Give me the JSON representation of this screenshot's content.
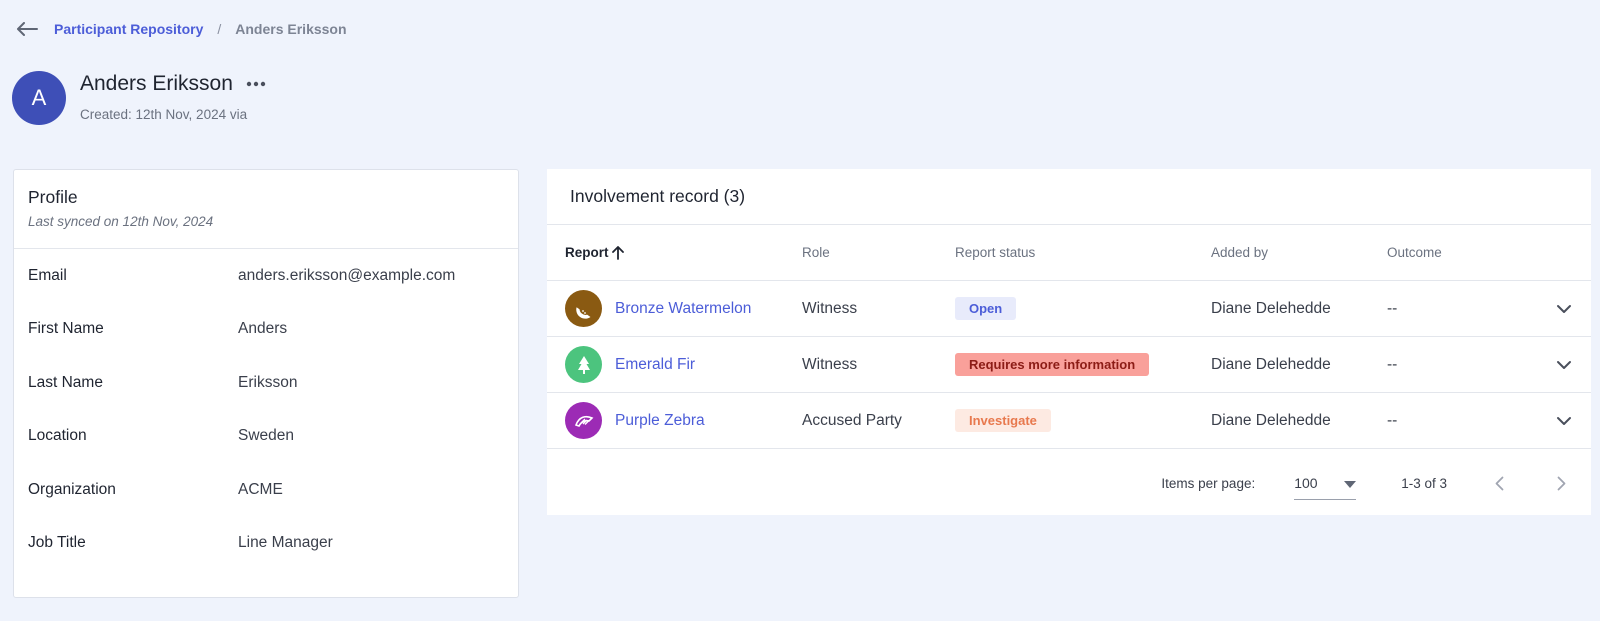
{
  "breadcrumb": {
    "parent": "Participant Repository",
    "separator": "/",
    "current": "Anders Eriksson"
  },
  "participant": {
    "initial": "A",
    "name": "Anders Eriksson",
    "created": "Created: 12th Nov, 2024 via",
    "avatar_color": "#3e4fb7"
  },
  "profile": {
    "title": "Profile",
    "last_synced": "Last synced on 12th Nov, 2024",
    "fields": [
      {
        "label": "Email",
        "value": "anders.eriksson@example.com"
      },
      {
        "label": "First Name",
        "value": "Anders"
      },
      {
        "label": "Last Name",
        "value": "Eriksson"
      },
      {
        "label": "Location",
        "value": "Sweden"
      },
      {
        "label": "Organization",
        "value": "ACME"
      },
      {
        "label": "Job Title",
        "value": "Line Manager"
      }
    ]
  },
  "involvement": {
    "title": "Involvement record (3)",
    "columns": {
      "report": "Report",
      "role": "Role",
      "status": "Report status",
      "added_by": "Added by",
      "outcome": "Outcome"
    },
    "rows": [
      {
        "report": "Bronze Watermelon",
        "icon": "watermelon-icon",
        "icon_color": "#8a5a12",
        "role": "Witness",
        "status": "Open",
        "status_bg": "#e8ebfb",
        "status_color": "#4c5dd8",
        "added_by": "Diane Delehedde",
        "outcome": "--"
      },
      {
        "report": "Emerald Fir",
        "icon": "fir-tree-icon",
        "icon_color": "#4cc47e",
        "role": "Witness",
        "status": "Requires more information",
        "status_bg": "#f9a09a",
        "status_color": "#8c1c16",
        "added_by": "Diane Delehedde",
        "outcome": "--"
      },
      {
        "report": "Purple Zebra",
        "icon": "zebra-icon",
        "icon_color": "#9c2bb5",
        "role": "Accused Party",
        "status": "Investigate",
        "status_bg": "#fdeae2",
        "status_color": "#e8794e",
        "added_by": "Diane Delehedde",
        "outcome": "--"
      }
    ],
    "pagination": {
      "items_per_page_label": "Items per page:",
      "items_per_page": "100",
      "range": "1-3 of 3"
    }
  }
}
